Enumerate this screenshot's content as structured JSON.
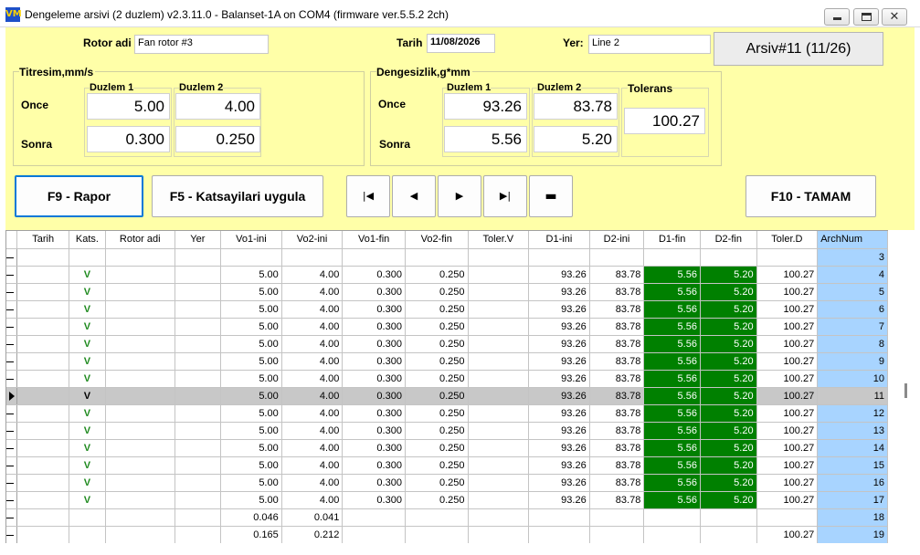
{
  "window": {
    "title": "Dengeleme arsivi (2 duzlem) v2.3.11.0 - Balanset-1A on COM4 (firmware ver.5.5.2 2ch)",
    "icon_text": "VM",
    "icon_color": "#1e50c8"
  },
  "header": {
    "rotor_label": "Rotor adi",
    "rotor_value": "Fan rotor #3",
    "date_label": "Tarih",
    "date_value": "11/08/2026",
    "place_label": "Yer:",
    "place_value": "Line 2",
    "archive_button": "Arsiv#11 (11/26)"
  },
  "vibration": {
    "title": "Titresim,mm/s",
    "plane1_label": "Duzlem 1",
    "plane2_label": "Duzlem 2",
    "before_label": "Once",
    "after_label": "Sonra",
    "before_p1": "5.00",
    "before_p2": "4.00",
    "after_p1": "0.300",
    "after_p2": "0.250"
  },
  "unbalance": {
    "title": "Dengesizlik,g*mm",
    "plane1_label": "Duzlem 1",
    "plane2_label": "Duzlem 2",
    "tolerance_label": "Tolerans",
    "before_label": "Once",
    "after_label": "Sonra",
    "before_p1": "93.26",
    "before_p2": "83.78",
    "after_p1": "5.56",
    "after_p2": "5.20",
    "tolerance_value": "100.27"
  },
  "buttons": {
    "report": "F9 - Rapor",
    "apply_coeffs": "F5 - Katsayilari uygula",
    "first": "|◀",
    "prev": "◀",
    "next": "▶",
    "last": "▶|",
    "delete": "▬",
    "done": "F10 - TAMAM"
  },
  "grid": {
    "columns": [
      "Tarih",
      "Kats.",
      "Rotor adi",
      "Yer",
      "Vo1-ini",
      "Vo2-ini",
      "Vo1-fin",
      "Vo2-fin",
      "Toler.V",
      "D1-ini",
      "D2-ini",
      "D1-fin",
      "D2-fin",
      "Toler.D",
      "ArchNum"
    ],
    "selected_row": 8,
    "rows": [
      [
        "",
        "",
        "",
        "",
        "",
        "",
        "",
        "",
        "",
        "",
        "",
        "",
        "",
        "",
        "3"
      ],
      [
        "",
        "V",
        "",
        "",
        "5.00",
        "4.00",
        "0.300",
        "0.250",
        "",
        "93.26",
        "83.78",
        "5.56",
        "5.20",
        "100.27",
        "4"
      ],
      [
        "",
        "V",
        "",
        "",
        "5.00",
        "4.00",
        "0.300",
        "0.250",
        "",
        "93.26",
        "83.78",
        "5.56",
        "5.20",
        "100.27",
        "5"
      ],
      [
        "",
        "V",
        "",
        "",
        "5.00",
        "4.00",
        "0.300",
        "0.250",
        "",
        "93.26",
        "83.78",
        "5.56",
        "5.20",
        "100.27",
        "6"
      ],
      [
        "",
        "V",
        "",
        "",
        "5.00",
        "4.00",
        "0.300",
        "0.250",
        "",
        "93.26",
        "83.78",
        "5.56",
        "5.20",
        "100.27",
        "7"
      ],
      [
        "",
        "V",
        "",
        "",
        "5.00",
        "4.00",
        "0.300",
        "0.250",
        "",
        "93.26",
        "83.78",
        "5.56",
        "5.20",
        "100.27",
        "8"
      ],
      [
        "",
        "V",
        "",
        "",
        "5.00",
        "4.00",
        "0.300",
        "0.250",
        "",
        "93.26",
        "83.78",
        "5.56",
        "5.20",
        "100.27",
        "9"
      ],
      [
        "",
        "V",
        "",
        "",
        "5.00",
        "4.00",
        "0.300",
        "0.250",
        "",
        "93.26",
        "83.78",
        "5.56",
        "5.20",
        "100.27",
        "10"
      ],
      [
        "",
        "V",
        "",
        "",
        "5.00",
        "4.00",
        "0.300",
        "0.250",
        "",
        "93.26",
        "83.78",
        "5.56",
        "5.20",
        "100.27",
        "11"
      ],
      [
        "",
        "V",
        "",
        "",
        "5.00",
        "4.00",
        "0.300",
        "0.250",
        "",
        "93.26",
        "83.78",
        "5.56",
        "5.20",
        "100.27",
        "12"
      ],
      [
        "",
        "V",
        "",
        "",
        "5.00",
        "4.00",
        "0.300",
        "0.250",
        "",
        "93.26",
        "83.78",
        "5.56",
        "5.20",
        "100.27",
        "13"
      ],
      [
        "",
        "V",
        "",
        "",
        "5.00",
        "4.00",
        "0.300",
        "0.250",
        "",
        "93.26",
        "83.78",
        "5.56",
        "5.20",
        "100.27",
        "14"
      ],
      [
        "",
        "V",
        "",
        "",
        "5.00",
        "4.00",
        "0.300",
        "0.250",
        "",
        "93.26",
        "83.78",
        "5.56",
        "5.20",
        "100.27",
        "15"
      ],
      [
        "",
        "V",
        "",
        "",
        "5.00",
        "4.00",
        "0.300",
        "0.250",
        "",
        "93.26",
        "83.78",
        "5.56",
        "5.20",
        "100.27",
        "16"
      ],
      [
        "",
        "V",
        "",
        "",
        "5.00",
        "4.00",
        "0.300",
        "0.250",
        "",
        "93.26",
        "83.78",
        "5.56",
        "5.20",
        "100.27",
        "17"
      ],
      [
        "",
        "",
        "",
        "",
        "0.046",
        "0.041",
        "",
        "",
        "",
        "",
        "",
        "",
        "",
        "",
        "18"
      ],
      [
        "",
        "",
        "",
        "",
        "0.165",
        "0.212",
        "",
        "",
        "",
        "",
        "",
        "",
        "",
        "100.27",
        "19"
      ]
    ]
  },
  "colors": {
    "form_background": "#ffffa8",
    "fin_cell": "#008000",
    "archnum_cell": "#a8d4ff",
    "selected_row": "#c8c8c8"
  }
}
